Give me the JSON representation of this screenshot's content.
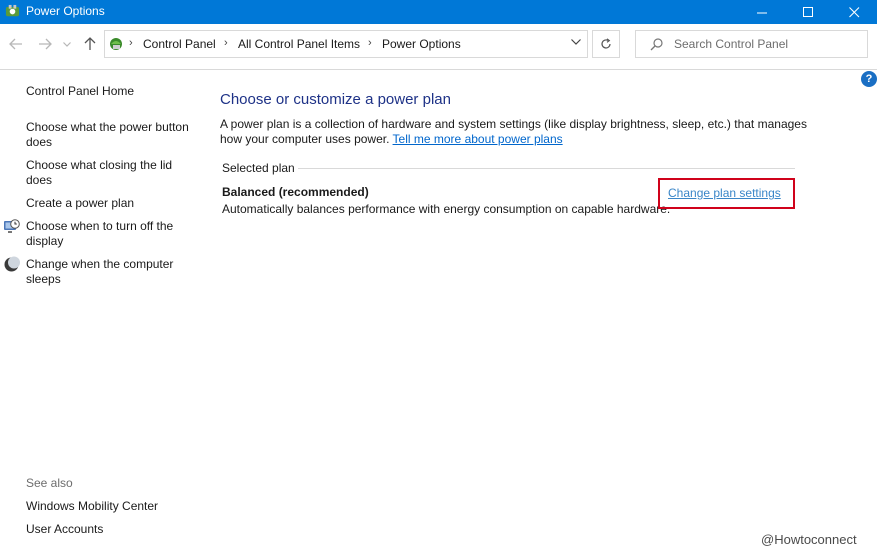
{
  "window": {
    "title": "Power Options",
    "controls": {
      "minimize": "minimize",
      "maximize": "maximize",
      "close": "close"
    }
  },
  "navigation": {
    "breadcrumb": [
      "Control Panel",
      "All Control Panel Items",
      "Power Options"
    ],
    "search_placeholder": "Search Control Panel"
  },
  "help": {
    "label": "?"
  },
  "sidebar": {
    "home": "Control Panel Home",
    "links": [
      {
        "label": "Choose what the power button does",
        "icon": null
      },
      {
        "label": "Choose what closing the lid does",
        "icon": null
      },
      {
        "label": "Create a power plan",
        "icon": null
      },
      {
        "label": "Choose when to turn off the display",
        "icon": "display-clock-icon"
      },
      {
        "label": "Change when the computer sleeps",
        "icon": "moon-icon"
      }
    ],
    "see_also_heading": "See also",
    "see_also": [
      "Windows Mobility Center",
      "User Accounts"
    ]
  },
  "main": {
    "title": "Choose or customize a power plan",
    "description": "A power plan is a collection of hardware and system settings (like display brightness, sleep, etc.) that manages how your computer uses power.",
    "learn_more_link": "Tell me more about power plans",
    "group_label": "Selected plan",
    "plan": {
      "name": "Balanced (recommended)",
      "description": "Automatically balances performance with energy consumption on capable hardware.",
      "change_link": "Change plan settings"
    }
  },
  "watermark": "@Howtoconnect",
  "colors": {
    "titlebar": "#0078d7",
    "heading": "#1e3287",
    "link": "#0066cc",
    "highlight": "#d0021b"
  }
}
